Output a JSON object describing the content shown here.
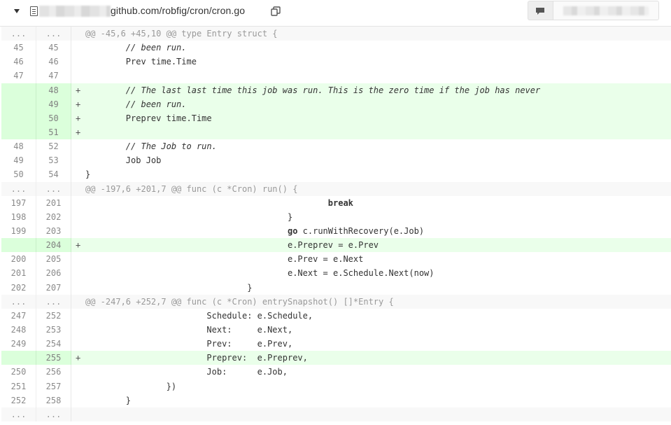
{
  "file": {
    "path": "github.com/robfig/cron/cron.go"
  },
  "icons": {
    "toggle": "caret-down-icon",
    "file": "file-icon",
    "copy": "clipboard-icon",
    "comment": "comment-icon"
  },
  "colors": {
    "added_row": "#eaffea",
    "added_gutter": "#dbffdb",
    "hunk_row": "#f8f8f8"
  },
  "rows": [
    {
      "type": "hunk",
      "old": "...",
      "new": "...",
      "text": "@@ -45,6 +45,10 @@ type Entry struct {"
    },
    {
      "type": "ctx",
      "old": "45",
      "new": "45",
      "text": "        // been run.",
      "style": "comment"
    },
    {
      "type": "ctx",
      "old": "46",
      "new": "46",
      "text": "        Prev time.Time"
    },
    {
      "type": "ctx",
      "old": "47",
      "new": "47",
      "text": ""
    },
    {
      "type": "add",
      "old": "",
      "new": "48",
      "text": "        // The last last time this job was run. This is the zero time if the job has never",
      "style": "comment"
    },
    {
      "type": "add",
      "old": "",
      "new": "49",
      "text": "        // been run.",
      "style": "comment"
    },
    {
      "type": "add",
      "old": "",
      "new": "50",
      "text": "        Preprev time.Time"
    },
    {
      "type": "add",
      "old": "",
      "new": "51",
      "text": ""
    },
    {
      "type": "ctx",
      "old": "48",
      "new": "52",
      "text": "        // The Job to run.",
      "style": "comment"
    },
    {
      "type": "ctx",
      "old": "49",
      "new": "53",
      "text": "        Job Job"
    },
    {
      "type": "ctx",
      "old": "50",
      "new": "54",
      "text": "}"
    },
    {
      "type": "hunk",
      "old": "...",
      "new": "...",
      "text": "@@ -197,6 +201,7 @@ func (c *Cron) run() {"
    },
    {
      "type": "ctx",
      "old": "197",
      "new": "201",
      "pre": "                                                ",
      "kw": "break",
      "text": ""
    },
    {
      "type": "ctx",
      "old": "198",
      "new": "202",
      "text": "                                        }"
    },
    {
      "type": "ctx",
      "old": "199",
      "new": "203",
      "pre": "                                        ",
      "kw": "go",
      "text": " c.runWithRecovery(e.Job)"
    },
    {
      "type": "add",
      "old": "",
      "new": "204",
      "text": "                                        e.Preprev = e.Prev"
    },
    {
      "type": "ctx",
      "old": "200",
      "new": "205",
      "text": "                                        e.Prev = e.Next"
    },
    {
      "type": "ctx",
      "old": "201",
      "new": "206",
      "text": "                                        e.Next = e.Schedule.Next(now)"
    },
    {
      "type": "ctx",
      "old": "202",
      "new": "207",
      "text": "                                }"
    },
    {
      "type": "hunk",
      "old": "...",
      "new": "...",
      "text": "@@ -247,6 +252,7 @@ func (c *Cron) entrySnapshot() []*Entry {"
    },
    {
      "type": "ctx",
      "old": "247",
      "new": "252",
      "text": "                        Schedule: e.Schedule,"
    },
    {
      "type": "ctx",
      "old": "248",
      "new": "253",
      "text": "                        Next:     e.Next,"
    },
    {
      "type": "ctx",
      "old": "249",
      "new": "254",
      "text": "                        Prev:     e.Prev,"
    },
    {
      "type": "add",
      "old": "",
      "new": "255",
      "text": "                        Preprev:  e.Preprev,"
    },
    {
      "type": "ctx",
      "old": "250",
      "new": "256",
      "text": "                        Job:      e.Job,"
    },
    {
      "type": "ctx",
      "old": "251",
      "new": "257",
      "text": "                })"
    },
    {
      "type": "ctx",
      "old": "252",
      "new": "258",
      "text": "        }"
    },
    {
      "type": "hunk",
      "old": "...",
      "new": "...",
      "text": ""
    }
  ]
}
